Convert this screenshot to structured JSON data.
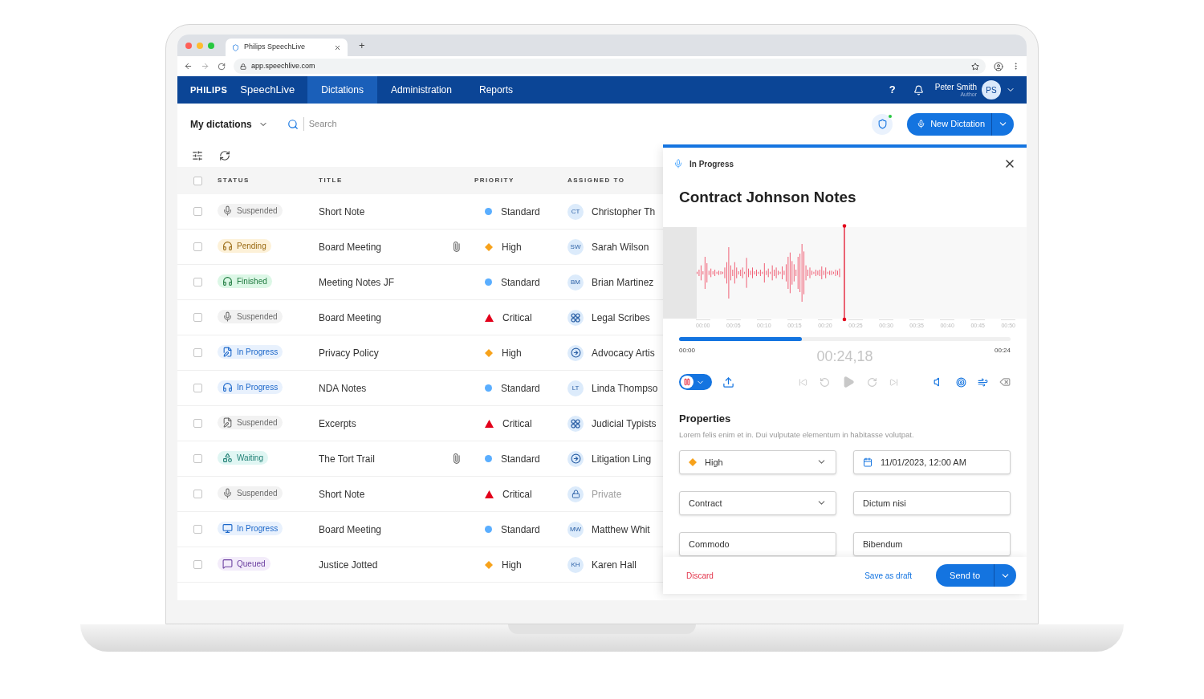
{
  "browser": {
    "tab_title": "Philips SpeechLive",
    "new_tab": "+",
    "url": "app.speechlive.com"
  },
  "header": {
    "brand": "PHILIPS",
    "product": "SpeechLive",
    "nav": [
      {
        "label": "Dictations",
        "selected": true
      },
      {
        "label": "Administration",
        "selected": false
      },
      {
        "label": "Reports",
        "selected": false
      }
    ],
    "help": "?",
    "user": {
      "name": "Peter Smith",
      "role": "Author",
      "initials": "PS"
    }
  },
  "toolbar": {
    "view": "My dictations",
    "search": {
      "placeholder": "Search"
    },
    "new_button": "New Dictation"
  },
  "table": {
    "header_checked": false,
    "columns": [
      "STATUS",
      "TITLE",
      "PRIORITY",
      "ASSIGNED TO"
    ],
    "rows": [
      {
        "checked": false,
        "status": {
          "label": "Suspended",
          "kind": "suspended",
          "medium": {
            "kind": "mic"
          }
        },
        "title": "Short Note",
        "attachment": false,
        "priority": {
          "label": "Standard",
          "kind": "standard"
        },
        "assignee": {
          "kind": "person",
          "initials": "CT",
          "name": "Christopher Th"
        }
      },
      {
        "checked": false,
        "status": {
          "label": "Pending",
          "kind": "pending",
          "medium": {
            "kind": "headphones"
          }
        },
        "title": "Board Meeting",
        "attachment": true,
        "priority": {
          "label": "High",
          "kind": "high"
        },
        "assignee": {
          "kind": "person",
          "initials": "SW",
          "name": "Sarah Wilson"
        }
      },
      {
        "checked": false,
        "status": {
          "label": "Finished",
          "kind": "finished",
          "medium": {
            "kind": "headphones"
          }
        },
        "title": "Meeting Notes JF",
        "attachment": false,
        "priority": {
          "label": "Standard",
          "kind": "standard"
        },
        "assignee": {
          "kind": "person",
          "initials": "BM",
          "name": "Brian Martinez"
        }
      },
      {
        "checked": false,
        "status": {
          "label": "Suspended",
          "kind": "suspended",
          "medium": {
            "kind": "mic"
          }
        },
        "title": "Board Meeting",
        "attachment": false,
        "priority": {
          "label": "Critical",
          "kind": "critical"
        },
        "assignee": {
          "kind": "team",
          "name": "Legal Scribes"
        }
      },
      {
        "checked": false,
        "status": {
          "label": "In Progress",
          "kind": "in_progress",
          "medium": {
            "kind": "document"
          }
        },
        "title": "Privacy Policy",
        "attachment": false,
        "priority": {
          "label": "High",
          "kind": "high"
        },
        "assignee": {
          "kind": "service",
          "name": "Advocacy Artis"
        }
      },
      {
        "checked": false,
        "status": {
          "label": "In Progress",
          "kind": "in_progress",
          "medium": {
            "kind": "headphones"
          }
        },
        "title": "NDA Notes",
        "attachment": false,
        "priority": {
          "label": "Standard",
          "kind": "standard"
        },
        "assignee": {
          "kind": "person",
          "initials": "LT",
          "name": "Linda Thompso"
        }
      },
      {
        "checked": false,
        "status": {
          "label": "Suspended",
          "kind": "suspended",
          "medium": {
            "kind": "document"
          }
        },
        "title": "Excerpts",
        "attachment": false,
        "priority": {
          "label": "Critical",
          "kind": "critical"
        },
        "assignee": {
          "kind": "team",
          "name": "Judicial Typists"
        }
      },
      {
        "checked": false,
        "status": {
          "label": "Waiting",
          "kind": "waiting",
          "medium": {
            "kind": "shapes"
          }
        },
        "title": "The Tort Trail",
        "attachment": true,
        "priority": {
          "label": "Standard",
          "kind": "standard"
        },
        "assignee": {
          "kind": "service",
          "name": "Litigation Ling"
        }
      },
      {
        "checked": false,
        "status": {
          "label": "Suspended",
          "kind": "suspended",
          "medium": {
            "kind": "mic"
          }
        },
        "title": "Short Note",
        "attachment": false,
        "priority": {
          "label": "Critical",
          "kind": "critical"
        },
        "assignee": {
          "kind": "private",
          "name": "Private"
        }
      },
      {
        "checked": false,
        "status": {
          "label": "In Progress",
          "kind": "in_progress",
          "medium": {
            "kind": "screen"
          }
        },
        "title": "Board Meeting",
        "attachment": false,
        "priority": {
          "label": "Standard",
          "kind": "standard"
        },
        "assignee": {
          "kind": "person",
          "initials": "MW",
          "name": "Matthew Whit"
        }
      },
      {
        "checked": false,
        "status": {
          "label": "Queued",
          "kind": "queued",
          "medium": {
            "kind": "chat"
          }
        },
        "title": "Justice Jotted",
        "attachment": false,
        "priority": {
          "label": "High",
          "kind": "high"
        },
        "assignee": {
          "kind": "person",
          "initials": "KH",
          "name": "Karen Hall"
        }
      }
    ]
  },
  "panel": {
    "status": "In Progress",
    "recorder": {
      "kind": "recording"
    },
    "title": "Contract Johnson Notes",
    "ticks": [
      "00:00",
      "00:05",
      "00:10",
      "00:15",
      "00:20",
      "00:25",
      "00:30",
      "00:35",
      "00:40",
      "00:45",
      "00:50"
    ],
    "progress": {
      "level": 0.37,
      "start": "00:00",
      "end": "00:24",
      "current": "00:24,18"
    },
    "properties": {
      "title": "Properties",
      "description": "Lorem felis enim et in. Dui vulputate elementum in habitasse volutpat.",
      "fields": [
        {
          "kind": "select",
          "value": "High",
          "priority": {
            "kind": "high"
          }
        },
        {
          "kind": "date",
          "value": "11/01/2023, 12:00 AM"
        },
        {
          "kind": "select",
          "value": "Contract"
        },
        {
          "kind": "text",
          "value": "Dictum nisi"
        },
        {
          "kind": "text",
          "value": "Commodo"
        },
        {
          "kind": "text",
          "value": "Bibendum"
        }
      ]
    },
    "footer": {
      "discard": "Discard",
      "draft": "Save as draft",
      "send": "Send to"
    }
  }
}
